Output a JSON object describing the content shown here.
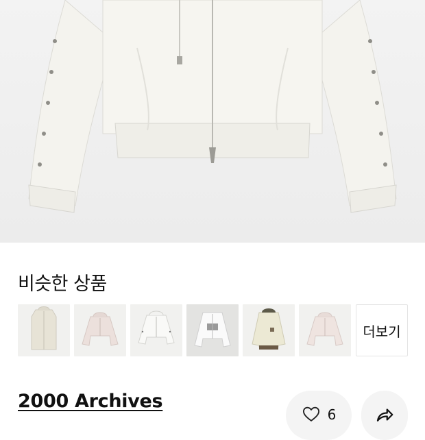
{
  "hero": {
    "image_description": "white zip-up hoodie with pin-detail sleeves",
    "background": "#eeeeee"
  },
  "similar": {
    "title": "비슷한 상품",
    "more_label": "더보기",
    "items": [
      {
        "icon": "beige-hoodie-thumbnail"
      },
      {
        "icon": "pink-hoodie-thumbnail"
      },
      {
        "icon": "white-hoodie-pins-thumbnail"
      },
      {
        "icon": "white-graphic-hoodie-thumbnail"
      },
      {
        "icon": "cream-hoodie-brown-trim-thumbnail"
      },
      {
        "icon": "pink-zip-hoodie-thumbnail"
      }
    ]
  },
  "shop": {
    "name": "2000 Archives"
  },
  "actions": {
    "like_count": "6",
    "like_icon": "heart-icon",
    "share_icon": "share-arrow-icon"
  }
}
